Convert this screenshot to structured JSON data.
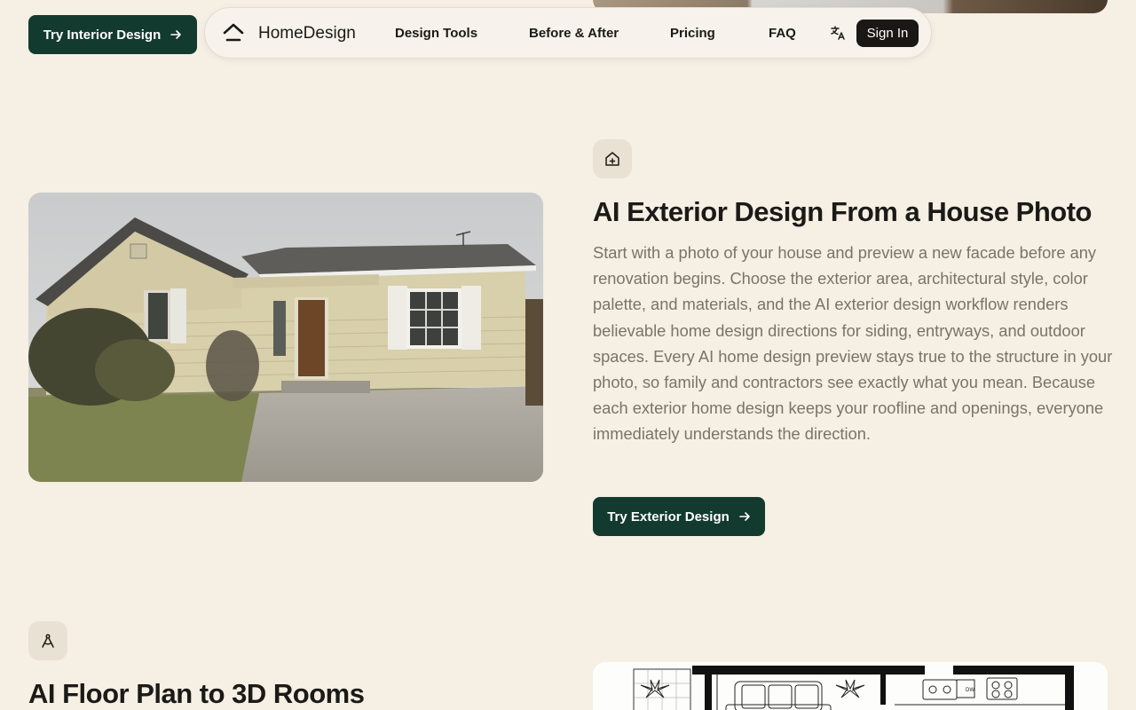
{
  "nav": {
    "brand": "HomeDesign",
    "links": [
      "Design Tools",
      "Before & After",
      "Pricing",
      "FAQ"
    ],
    "sign_in": "Sign In"
  },
  "interior_cta": "Try Interior Design",
  "exterior": {
    "title": "AI Exterior Design From a House Photo",
    "body": "Start with a photo of your house and preview a new facade before any renovation begins. Choose the exterior area, architectural style, color palette, and materials, and the AI exterior design workflow renders believable home design directions for siding, entryways, and outdoor spaces. Every AI home design preview stays true to the structure in your photo, so family and contractors see exactly what you mean. Because each exterior home design keeps your roofline and openings, everyone immediately understands the direction.",
    "cta": "Try Exterior Design"
  },
  "floorplan": {
    "title": "AI Floor Plan to 3D Rooms",
    "label_dw": "DW"
  },
  "colors": {
    "background": "#f5efe4",
    "accent": "#133a2e",
    "dark": "#1a1715",
    "muted_text": "#7a7369"
  }
}
